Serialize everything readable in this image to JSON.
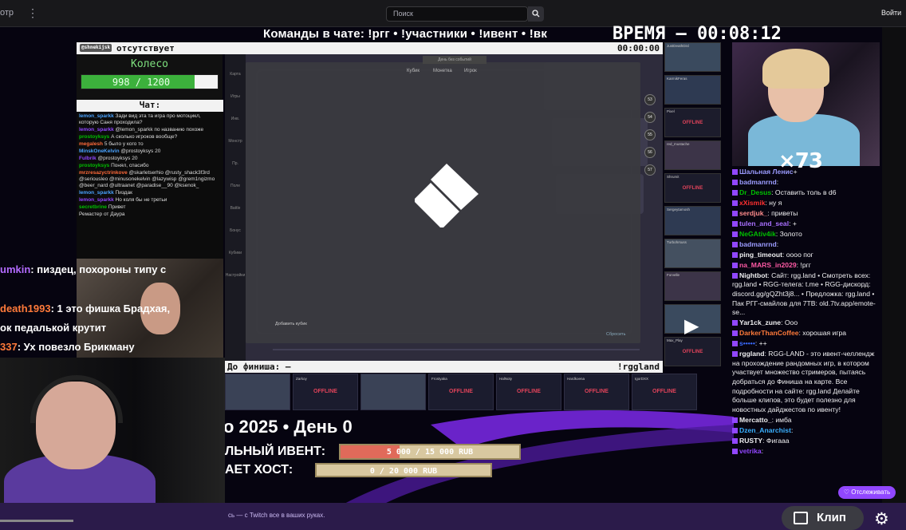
{
  "topbar": {
    "left_label": "отр",
    "search_placeholder": "Поиск",
    "login": "Войти"
  },
  "overlay": {
    "commands": "Команды в чате: !ргг • !участники • !ивент • !вк",
    "timer": "ВРЕМЯ — 00:08:12",
    "status": "отсутствует",
    "status_tag": "@shnekijsk",
    "clock": "00:00:00",
    "wheel_title": "Колесо",
    "wheel_value": "998 / 1200",
    "wheel_progress": 0.83,
    "chat_title": "Чат:",
    "finish_label": "До финиша: —",
    "site": "!rggland",
    "day_line": "о 2025 • День 0",
    "ivent_label": "ЛЬНЫЙ ИВЕНТ:",
    "ivent_value": "5 000 / 15 000 RUB",
    "ivent_progress": 0.33,
    "host_label": "АЕТ ХОСТ:",
    "host_value": "0 / 20 000 RUB",
    "cam_count": "×73"
  },
  "game": {
    "modal_top": "День без событий",
    "tabs": [
      "Кубик",
      "Монетка",
      "Игрок"
    ],
    "sidebar_items": [
      "Карта",
      "Игры",
      "Инв.",
      "Монстр",
      "Пр.",
      "Поле",
      "Battle",
      "Бонус",
      "Кубики",
      "Настройки"
    ],
    "add_cubes": "Добавить кубик",
    "skip": "Сбросить",
    "track_numbers": [
      "53",
      "54",
      "55",
      "56",
      "57"
    ]
  },
  "left_chat": [
    {
      "name": "lemon_sparkk",
      "text": "Зади вид эта та игра про мотоцикл, которую Саня проходила?"
    },
    {
      "name": "lemon_sparkk",
      "text": "@lemon_sparkk по названию похоже"
    },
    {
      "name": "prostoyksys",
      "text": "А сколько игроков вообще?"
    },
    {
      "name": "megalesh",
      "text": "5 было у кого то"
    },
    {
      "name": "MinskOneKelvin",
      "text": "@prostoyksys 20"
    },
    {
      "name": "Fulbrik",
      "text": "@prostoyksys 20"
    },
    {
      "name": "prostoyksys",
      "text": "Понял, спасибо"
    },
    {
      "name": "mrzresazyctrinkove",
      "text": "@skarletserhio @rusty_shack3f3rd @seriousleo @minusonekelvin @lazywisp @grem1ngizmo @beer_nard @ultraanet @paradise__90 @ksenok_"
    },
    {
      "name": "lemon_sparkk",
      "text": "Пиздак"
    },
    {
      "name": "lemon_sparkk",
      "text": "Но коля бы не третьи"
    },
    {
      "name": "secretbrine",
      "text": "Привет"
    },
    {
      "name": "",
      "text": "Ремастер от Даура"
    }
  ],
  "big_chat": [
    {
      "name": "umkin",
      "text": ": пиздец, похороны типу с",
      "color": "#b36bff"
    },
    {
      "name": "death1993",
      "text": ": 1 это фишка Брадхая,",
      "color": "#ff7a3a"
    },
    {
      "name": "",
      "text": "ок педалькой крутит",
      "color": "#ffffff"
    },
    {
      "name": "337",
      "text": ": Ух повезло Брикману",
      "color": "#ff7a3a"
    }
  ],
  "thumbs": [
    {
      "name": "JustDeathDisl",
      "live": true
    },
    {
      "name": "KarmikFeras",
      "live": true
    },
    {
      "name": "Pixel",
      "live": false,
      "status": "OFFLINE"
    },
    {
      "name": "red_mustache",
      "live": true
    },
    {
      "name": "Shrumit",
      "live": false,
      "status": "OFFLINE"
    },
    {
      "name": "Sergeytamosh",
      "live": true
    },
    {
      "name": "Turbohrsuss",
      "live": true
    },
    {
      "name": "Forvelle",
      "live": true
    },
    {
      "name": "",
      "live": true
    },
    {
      "name": "Max_Play",
      "live": false,
      "status": "OFFLINE"
    }
  ],
  "bottom_thumbs": [
    {
      "name": "",
      "live": true
    },
    {
      "name": "Zarkoy",
      "live": false,
      "status": "OFFLINE"
    },
    {
      "name": "",
      "live": true
    },
    {
      "name": "Frostyaka",
      "live": false,
      "status": "OFFLINE"
    },
    {
      "name": "HalNoty",
      "live": false,
      "status": "OFFLINE"
    },
    {
      "name": "Hardkoena",
      "live": false,
      "status": "OFFLINE"
    },
    {
      "name": "IgorDXX",
      "live": false,
      "status": "OFFLINE"
    }
  ],
  "right_chat": [
    {
      "name": "Шальная Ленис",
      "text": "+",
      "color": "#9b9bff"
    },
    {
      "name": "badmanrnd",
      "text": ":",
      "color": "#9b9bff"
    },
    {
      "name": "Dr_Desus",
      "text": ": Оставить толь  в d6",
      "color": "#00c000"
    },
    {
      "name": "xXismik",
      "text": ": ну я",
      "color": "#ff3030"
    },
    {
      "name": "serdjuk_",
      "text": ": приветы",
      "color": "#ff8c8c"
    },
    {
      "name": "tulen_and_seal",
      "text": ": +",
      "color": "#a970ff"
    },
    {
      "name": "NeGAtiv4ik",
      "text": ": Золото",
      "color": "#00c000"
    },
    {
      "name": "badmanrnd",
      "text": ":",
      "color": "#9b9bff"
    },
    {
      "name": "ping_timeout",
      "text": ": оооо пог",
      "color": "#efeff1"
    },
    {
      "name": "na_MARS_in2029",
      "text": ": !ргг",
      "color": "#ff5aa5"
    },
    {
      "name": "Nightbot",
      "text": ": Сайт: rgg.land • Смотреть всех: rgg.land • RGG-телега: t.me • RGG-дискорд: discord.gg/gQZht3j8... • Предложка: rgg.land • Пак РГГ-смайлов для 7TB: old.7tv.app/emote-se...",
      "color": "#efeff1"
    },
    {
      "name": "Yar1ck_zune",
      "text": ": Ооо",
      "color": "#efeff1"
    },
    {
      "name": "DarkerThanCoffee",
      "text": ": хорошая игра",
      "color": "#ff7a3a"
    },
    {
      "name": "s•••••",
      "text": ": ++",
      "color": "#3a6bff"
    },
    {
      "name": "rggland",
      "text": ": RGG-LAND - это ивент-челлендж на прохождение рандомных игр, в котором участвует множество стримеров, пытаясь добраться до Финиша на карте. Все подробности на сайте: rgg.land Делайте больше клипов, это будет полезно для новостных дайджестов по ивенту!",
      "color": "#efeff1"
    },
    {
      "name": "Mercatto_",
      "text": ": имба",
      "color": "#efeff1"
    },
    {
      "name": "Dzen_Anarchist",
      "text": ":",
      "color": "#3ab0ff"
    },
    {
      "name": "RUSTY",
      "text": ": Фигааа",
      "color": "#efeff1"
    },
    {
      "name": "vetrika",
      "text": ":",
      "color": "#9147ff"
    }
  ],
  "follow_button": "Отслеживать",
  "bottom_text": "сь — с Twitch все в ваших руках.",
  "clip_button": "Клип",
  "icons": {
    "search": "search-icon",
    "settings": "gear-icon",
    "clip": "clapperboard-icon",
    "kebab": "kebab-menu-icon"
  }
}
